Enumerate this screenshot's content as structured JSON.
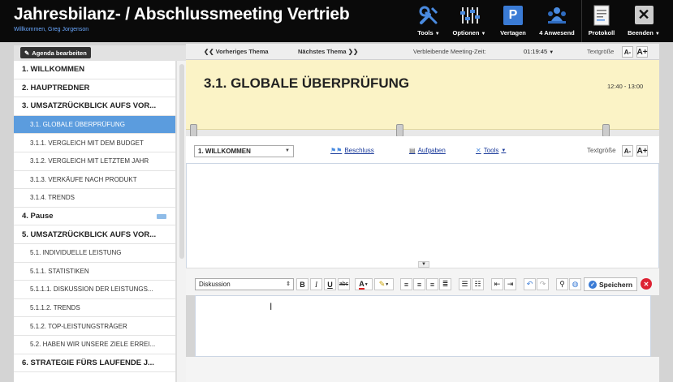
{
  "header": {
    "title": "Jahresbilanz- / Abschlussmeeting Vertrieb",
    "welcome": "Willkommen, Greg Jorgenson",
    "buttons": {
      "tools": "Tools",
      "options": "Optionen",
      "vertagen": "Vertagen",
      "attendees": "4 Anwesend",
      "protokoll": "Protokoll",
      "beenden": "Beenden"
    },
    "vertagen_glyph": "P",
    "colors": {
      "background": "#0a0a0a",
      "accent": "#3a7bd5"
    }
  },
  "left": {
    "edit_button": "Agenda bearbeiten",
    "items": [
      {
        "label": "1. WILLKOMMEN",
        "level": 1
      },
      {
        "label": "2. HAUPTREDNER",
        "level": 1
      },
      {
        "label": "3. UMSATZRÜCKBLICK AUFS VOR...",
        "level": 1
      },
      {
        "label": "3.1. GLOBALE ÜBERPRÜFUNG",
        "level": 2,
        "active": true
      },
      {
        "label": "3.1.1. VERGLEICH MIT DEM BUDGET",
        "level": 2
      },
      {
        "label": "3.1.2. VERGLEICH MIT LETZTEM JAHR",
        "level": 2
      },
      {
        "label": "3.1.3. VERKÄUFE NACH PRODUKT",
        "level": 2
      },
      {
        "label": "3.1.4. TRENDS",
        "level": 2
      },
      {
        "label": "4. Pause",
        "level": 1,
        "icon": "break-icon"
      },
      {
        "label": "5. UMSATZRÜCKBLICK AUFS VOR...",
        "level": 1
      },
      {
        "label": "5.1. INDIVIDUELLE LEISTUNG",
        "level": 2
      },
      {
        "label": "5.1.1. STATISTIKEN",
        "level": 2
      },
      {
        "label": "5.1.1.1. DISKUSSION DER LEISTUNGS...",
        "level": 2
      },
      {
        "label": "5.1.1.2. TRENDS",
        "level": 2
      },
      {
        "label": "5.1.2. TOP-LEISTUNGSTRÄGER",
        "level": 2
      },
      {
        "label": "5.2. HABEN WIR UNSERE ZIELE ERREI...",
        "level": 2
      },
      {
        "label": "6. STRATEGIE FÜRS LAUFENDE J...",
        "level": 1
      }
    ]
  },
  "nav": {
    "prev": "Vorheriges Thema",
    "next": "Nächstes Thema",
    "remaining_label": "Verbleibende Meeting-Zeit:",
    "remaining_time": "01:19:45",
    "font_size_label": "Textgröße",
    "font_smaller": "A-",
    "font_bigger": "A+"
  },
  "topic": {
    "title": "3.1. GLOBALE ÜBERPRÜFUNG",
    "time": "12:40 - 13:00",
    "background": "#fbf3c6"
  },
  "subtoolbar": {
    "selected_topic": "1. WILLKOMMEN",
    "beschluss": "Beschluss",
    "aufgaben": "Aufgaben",
    "tools": "Tools",
    "font_size_label": "Textgröße",
    "font_smaller": "A-",
    "font_bigger": "A+"
  },
  "editor": {
    "style": "Diskussion",
    "bold": "B",
    "italic": "I",
    "underline": "U",
    "strike": "abc",
    "font_color": "A",
    "save": "Speichern"
  }
}
